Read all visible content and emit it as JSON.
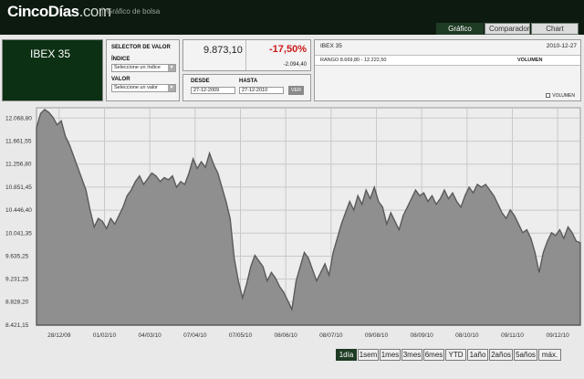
{
  "header": {
    "logo_main": "CincoDías",
    "logo_domain": ".com",
    "subtitle": "Gráfico de bolsa",
    "tabs": [
      {
        "label": "Gráfico",
        "active": true
      },
      {
        "label": "Comparador",
        "active": false
      },
      {
        "label": "Chart",
        "active": false
      }
    ]
  },
  "index_name": "IBEX 35",
  "selector": {
    "title": "SELECTOR DE VALOR",
    "indice_label": "ÍNDICE",
    "indice_value": "Seleccione un índice",
    "valor_label": "VALOR",
    "valor_value": "Seleccione un valor"
  },
  "quote": {
    "price": "9.873,10",
    "change_pct": "-17,50%",
    "change_abs": "-2.094,40"
  },
  "date_range": {
    "desde_label": "DESDE",
    "desde_value": "27-12-2009",
    "hasta_label": "HASTA",
    "hasta_value": "27-12-2010",
    "ver_label": "VER"
  },
  "info": {
    "title": "IBEX 35",
    "date": "2010-12-27",
    "rango_text": "RANGO 8.669,80 - 12.222,50",
    "volumen_label": "VOLUMEN",
    "volumen_check_label": "VOLUMEN"
  },
  "colors": {
    "accent_dark_green": "#1e3b24",
    "negative": "#cc1a1a",
    "area_fill": "#8f8f8f"
  },
  "chart_data": {
    "type": "area",
    "title": "",
    "xlabel": "",
    "ylabel": "",
    "ylim": [
      8421.15,
      12250
    ],
    "y_ticks": [
      {
        "value": 12068.8,
        "label": "12.068,80"
      },
      {
        "value": 11661.55,
        "label": "11.661,55"
      },
      {
        "value": 11256.8,
        "label": "11.256,80"
      },
      {
        "value": 10851.45,
        "label": "10.851,45"
      },
      {
        "value": 10446.4,
        "label": "10.446,40"
      },
      {
        "value": 10041.35,
        "label": "10.041,35"
      },
      {
        "value": 9635.25,
        "label": "9.635,25"
      },
      {
        "value": 9231.25,
        "label": "9.231,25"
      },
      {
        "value": 8828.2,
        "label": "8.828,20"
      },
      {
        "value": 8421.15,
        "label": "8.421,15"
      }
    ],
    "x_ticks": [
      "28/12/09",
      "01/02/10",
      "04/03/10",
      "07/04/10",
      "07/05/10",
      "08/06/10",
      "08/07/10",
      "09/08/10",
      "08/09/10",
      "08/10/10",
      "09/11/10",
      "09/12/10"
    ],
    "series": [
      {
        "values": [
          11900,
          12150,
          12220,
          12170,
          12080,
          11950,
          12020,
          11750,
          11600,
          11400,
          11200,
          11000,
          10800,
          10450,
          10150,
          10300,
          10250,
          10120,
          10300,
          10200,
          10350,
          10500,
          10700,
          10800,
          10950,
          11050,
          10900,
          11000,
          11100,
          11050,
          10950,
          11020,
          10980,
          11050,
          10850,
          10950,
          10900,
          11100,
          11350,
          11180,
          11300,
          11200,
          11450,
          11250,
          11100,
          10850,
          10600,
          10300,
          9600,
          9200,
          8900,
          9150,
          9450,
          9650,
          9550,
          9450,
          9200,
          9350,
          9250,
          9100,
          9000,
          8850,
          8700,
          9200,
          9450,
          9700,
          9600,
          9400,
          9200,
          9350,
          9500,
          9300,
          9700,
          9950,
          10200,
          10400,
          10600,
          10450,
          10700,
          10550,
          10800,
          10650,
          10850,
          10600,
          10500,
          10200,
          10400,
          10250,
          10100,
          10350,
          10500,
          10650,
          10800,
          10700,
          10750,
          10600,
          10700,
          10550,
          10650,
          10800,
          10650,
          10750,
          10600,
          10500,
          10700,
          10850,
          10750,
          10900,
          10850,
          10900,
          10800,
          10700,
          10550,
          10400,
          10300,
          10450,
          10350,
          10200,
          10050,
          10100,
          9950,
          9700,
          9350,
          9700,
          9900,
          10050,
          10000,
          10100,
          9950,
          10150,
          10050,
          9900,
          9873.1
        ]
      }
    ]
  },
  "range_buttons": [
    {
      "label": "1día",
      "active": true
    },
    {
      "label": "1sem",
      "active": false
    },
    {
      "label": "1mes",
      "active": false
    },
    {
      "label": "3mes",
      "active": false
    },
    {
      "label": "6mes",
      "active": false
    },
    {
      "label": "YTD",
      "active": false
    },
    {
      "label": "1año",
      "active": false
    },
    {
      "label": "2años",
      "active": false
    },
    {
      "label": "5años",
      "active": false
    },
    {
      "label": "máx.",
      "active": false
    }
  ]
}
